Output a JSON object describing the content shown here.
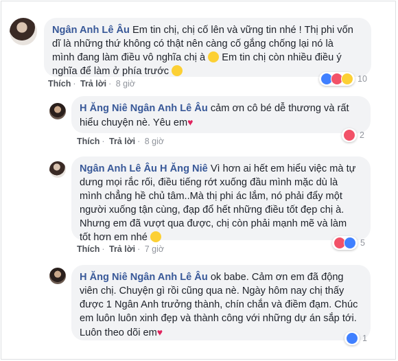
{
  "comments": [
    {
      "author": "Ngân Anh Lê Âu",
      "line1": "Em tin chị, chị cố lên và vững tin nhé ! Thị phi vốn",
      "line2": "dĩ là những thứ không có thật nên càng cố gắng chống lại nó là",
      "line3": "mình đang làm điều vô nghĩa chị à",
      "line3b": " Em tin chị còn nhiều điều ý",
      "line4": "nghĩa để làm ở phía trước",
      "like": "Thích",
      "reply": "Trả lời",
      "time": "8 giờ",
      "reaction_count": "10"
    },
    {
      "author": "H Ăng Niê",
      "mention": "Ngân Anh Lê Âu",
      "line1": " cảm ơn cô bé dễ thương và rất",
      "line2": "hiểu chuyện nè. Yêu em",
      "like": "Thích",
      "reply": "Trả lời",
      "time": "8 giờ",
      "reaction_count": "2"
    },
    {
      "author": "Ngân Anh Lê Âu",
      "mention": "H Ăng Niê",
      "line1": " Vì hơn ai hết em hiểu việc mà tự",
      "line2": "dưng mọi rắc rối, điều tiếng rớt xuống đầu mình mặc dù là",
      "line3": "mình chẳng hề chủ tâm..Mà thị phi ác lắm, nó phải đẩy một",
      "line4": "người xuống tận cùng, đạp đổ hết những điều tốt đẹp chị à.",
      "line5": "Nhưng em đã vượt qua được, chị còn phải mạnh mẽ và làm",
      "line6": "tốt hơn em nhé",
      "like": "Thích",
      "reply": "Trả lời",
      "time": "7 giờ",
      "reaction_count": "5"
    },
    {
      "author": "H Ăng Niê",
      "mention": "Ngân Anh Lê Âu",
      "line1": " ok babe. Cảm ơn em đã động",
      "line2": "viên chị. Chuyện gì rồi cũng qua nè. Ngày hôm nay chị thấy",
      "line3": "được 1 Ngân Anh trưởng thành, chín chắn và điềm đạm. Chúc",
      "line4": "em luôn luôn xinh đẹp và thành công với những dự án sắp tới.",
      "line5": "Luôn theo dõi em",
      "reaction_count": "1"
    }
  ],
  "colors": {
    "link": "#385898",
    "bubble": "#f2f3f5",
    "meta": "#90949c",
    "like": "#4080ff",
    "love": "#f25268",
    "haha": "#fcd035"
  }
}
